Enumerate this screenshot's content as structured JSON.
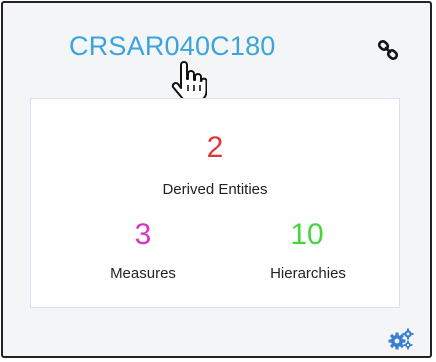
{
  "card": {
    "title": "CRSAR040C180",
    "link_icon": "link-icon",
    "settings_icon": "gears-icon",
    "accent_color": "#3ba4dd"
  },
  "stats": {
    "derived_entities": {
      "value": "2",
      "label": "Derived Entities",
      "color": "#e3343c"
    },
    "measures": {
      "value": "3",
      "label": "Measures",
      "color": "#d633c8"
    },
    "hierarchies": {
      "value": "10",
      "label": "Hierarchies",
      "color": "#44d63b"
    }
  }
}
